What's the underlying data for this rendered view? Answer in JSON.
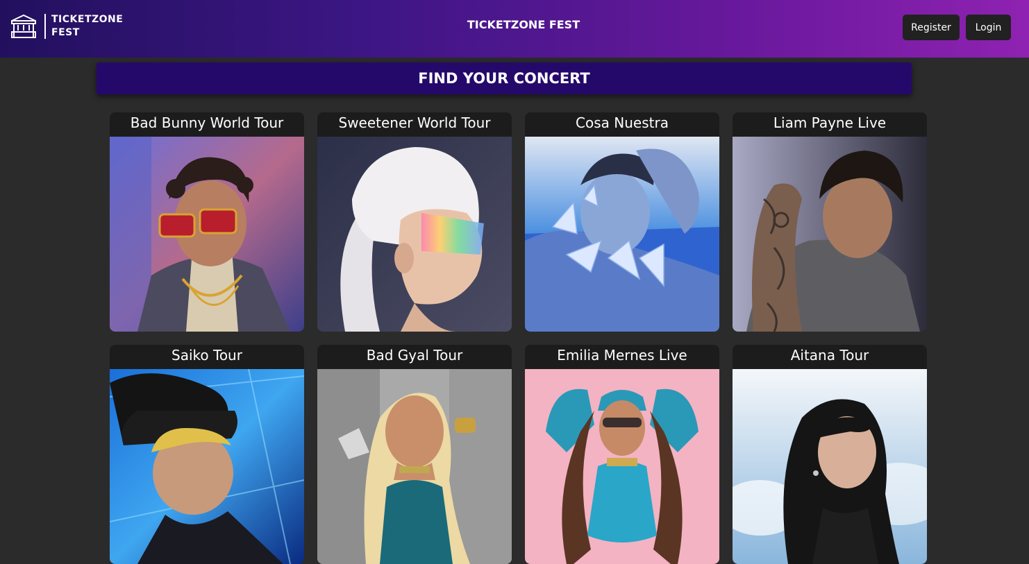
{
  "header": {
    "logo_line1": "TICKETZONE",
    "logo_line2": "FEST",
    "center_title": "TICKETZONE FEST",
    "register_label": "Register",
    "login_label": "Login"
  },
  "banner": {
    "title": "FIND YOUR CONCERT"
  },
  "concerts": [
    {
      "title": "Bad Bunny World Tour"
    },
    {
      "title": "Sweetener World Tour"
    },
    {
      "title": "Cosa Nuestra"
    },
    {
      "title": "Liam Payne Live"
    },
    {
      "title": "Saiko Tour"
    },
    {
      "title": "Bad Gyal Tour"
    },
    {
      "title": "Emilia Mernes Live"
    },
    {
      "title": "Aitana Tour"
    }
  ],
  "colors": {
    "header_gradient_start": "#22105e",
    "header_gradient_end": "#8f22b2",
    "banner": "#24096b",
    "page_background": "#2b2b2b",
    "card_background": "#1c1c1c",
    "button_background": "#212121"
  }
}
